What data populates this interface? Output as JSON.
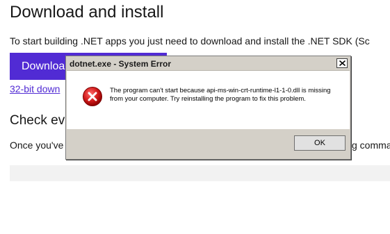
{
  "page": {
    "heading": "Download and install",
    "intro": "To start building .NET apps you just need to download and install the .NET SDK (Sc",
    "download_button": "Download",
    "alt_link": "32-bit down",
    "check_heading": "Check ev",
    "body_text": "Once you've",
    "body_tail": "g comma"
  },
  "dialog": {
    "title": "dotnet.exe - System Error",
    "close_symbol": "X",
    "message": "The program can't start because api-ms-win-crt-runtime-l1-1-0.dll is missing from your computer. Try reinstalling the program to fix this problem.",
    "ok_label": "OK",
    "icon": "error-icon"
  },
  "colors": {
    "accent": "#512bd4",
    "error_red": "#d11a1a",
    "dialog_bg": "#d4d0c8"
  }
}
